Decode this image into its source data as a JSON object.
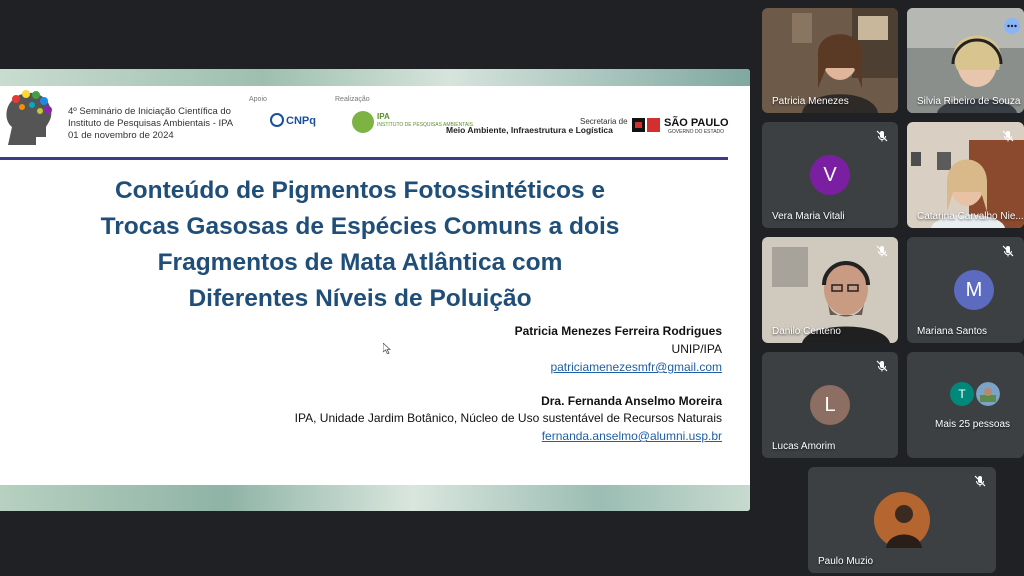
{
  "slide": {
    "seminar_lines": [
      "4º Seminário de Iniciação Científica do",
      "Instituto de Pesquisas Ambientais - IPA",
      "01 de novembro de 2024"
    ],
    "apoio_label": "Apoio",
    "realizacao_label": "Realização",
    "cnpq_logo": "CNPq",
    "ipa_logo": "IPA",
    "ipa_logo_sub": "INSTITUTO DE PESQUISAS AMBIENTAIS",
    "secretaria_label": "Secretaria de",
    "secretaria_text": "Meio Ambiente, Infraestrutura e Logística",
    "sp_logo": "SÃO PAULO",
    "sp_logo_sub": "GOVERNO DO ESTADO",
    "title_lines": [
      "Conteúdo de Pigmentos Fotossintéticos e",
      "Trocas Gasosas de Espécies Comuns a dois",
      "Fragmentos de Mata Atlântica com",
      "Diferentes Níveis de Poluição"
    ],
    "author1_name": "Patricia Menezes Ferreira Rodrigues",
    "author1_affil": "UNIP/IPA",
    "author1_email": "patriciamenezesmfr@gmail.com",
    "author2_name": "Dra. Fernanda Anselmo Moreira",
    "author2_affil": "IPA, Unidade Jardim Botânico, Núcleo de Uso sustentável de Recursos Naturais",
    "author2_email": "fernanda.anselmo@alumni.usp.br"
  },
  "participants": {
    "p1": {
      "name": "Patricia Menezes"
    },
    "p2": {
      "name": "Silvia Ribeiro de Souza"
    },
    "p3": {
      "name": "Vera Maria Vitali",
      "initial": "V",
      "color": "#7b1fa2"
    },
    "p4": {
      "name": "Catarina Carvalho Nie..."
    },
    "p5": {
      "name": "Danilo Centeno"
    },
    "p6": {
      "name": "Mariana Santos",
      "initial": "M",
      "color": "#5c6bc0"
    },
    "p7": {
      "name": "Lucas Amorim",
      "initial": "L",
      "color": "#8d6e63"
    },
    "p8": {
      "name": "Mais 25 pessoas",
      "initial": "T",
      "color": "#00897b"
    },
    "p9": {
      "name": "Paulo Muzio"
    }
  },
  "colors": {
    "background": "#202124",
    "tile": "#3c4043",
    "title": "#1f4e79",
    "active_outline": "#8ab4f8"
  },
  "icons": [
    "mic-off-icon",
    "more-options-icon",
    "cursor-icon"
  ]
}
